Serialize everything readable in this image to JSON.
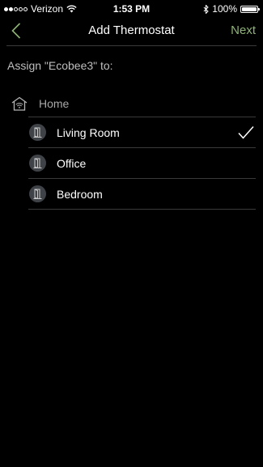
{
  "status_bar": {
    "carrier": "Verizon",
    "time": "1:53 PM",
    "battery": "100%",
    "signal_bars_filled": 2,
    "signal_bars_total": 5,
    "battery_level": 1.0
  },
  "nav": {
    "title": "Add Thermostat",
    "next_label": "Next",
    "back_icon": "chevron-left-icon"
  },
  "assign": {
    "label": "Assign \"Ecobee3\" to:"
  },
  "home": {
    "label": "Home",
    "icon": "home-wifi-icon"
  },
  "rooms": [
    {
      "label": "Living Room",
      "icon": "door-icon",
      "selected": true
    },
    {
      "label": "Office",
      "icon": "door-icon",
      "selected": false
    },
    {
      "label": "Bedroom",
      "icon": "door-icon",
      "selected": false
    }
  ],
  "colors": {
    "background": "#000000",
    "accent": "#8fb377",
    "divider": "#3a3a3a",
    "room_icon_bg": "#3f4348"
  }
}
